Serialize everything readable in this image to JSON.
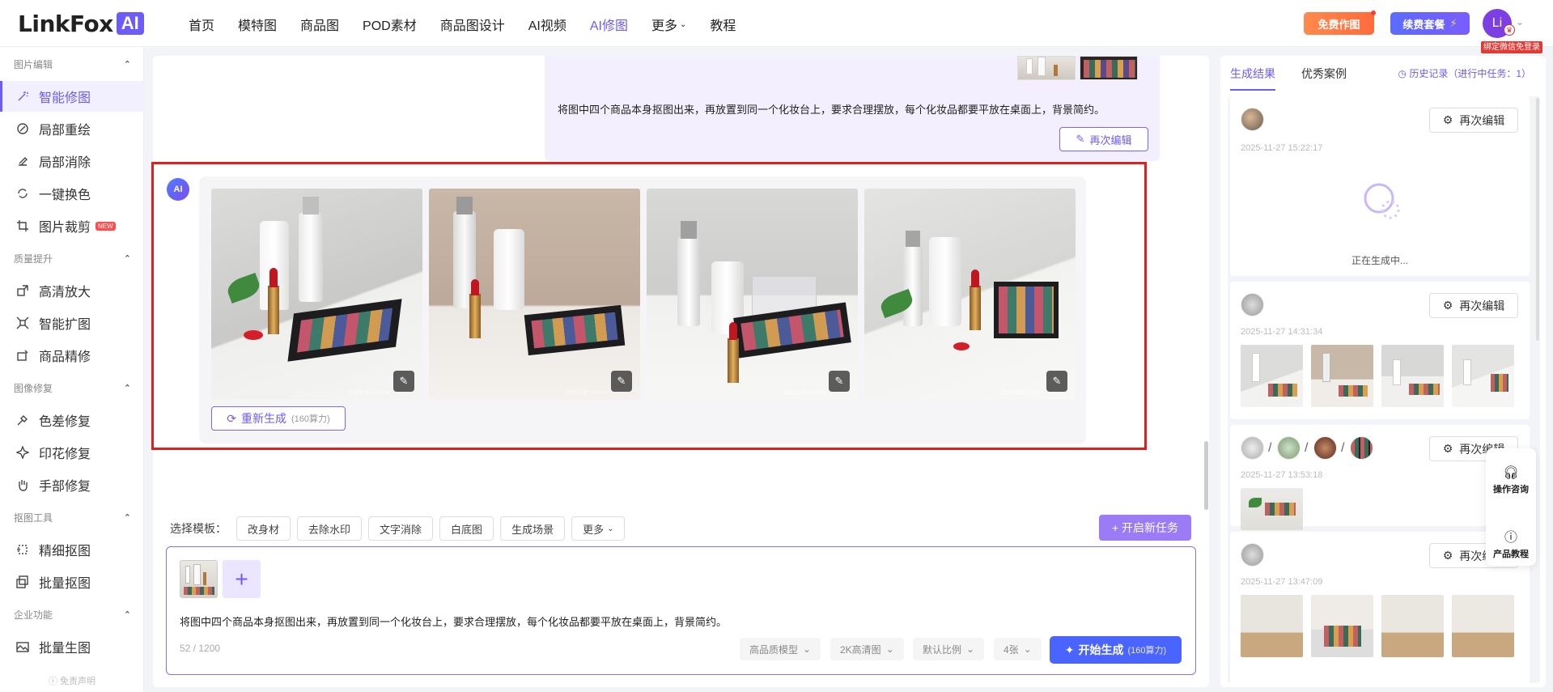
{
  "header": {
    "logo_text": "LinkFox",
    "logo_ai": "AI",
    "nav": [
      {
        "label": "首页",
        "active": false
      },
      {
        "label": "模特图",
        "active": false
      },
      {
        "label": "商品图",
        "active": false
      },
      {
        "label": "POD素材",
        "active": false
      },
      {
        "label": "商品图设计",
        "active": false
      },
      {
        "label": "AI视频",
        "active": false
      },
      {
        "label": "AI修图",
        "active": true
      },
      {
        "label": "更多",
        "active": false
      },
      {
        "label": "教程",
        "active": false
      }
    ],
    "free_btn": "免费作图",
    "plan_btn": "续费套餐",
    "avatar_initials": "Li",
    "bind_tag": "绑定微信免登录"
  },
  "sidebar": {
    "groups": [
      {
        "title": "图片编辑",
        "items": [
          {
            "label": "智能修图",
            "icon": "magic-wand-icon",
            "active": true
          },
          {
            "label": "局部重绘",
            "icon": "brush-icon"
          },
          {
            "label": "局部消除",
            "icon": "eraser-icon"
          },
          {
            "label": "一键换色",
            "icon": "color-swap-icon"
          },
          {
            "label": "图片裁剪",
            "icon": "crop-icon",
            "badge": "NEW"
          }
        ]
      },
      {
        "title": "质量提升",
        "items": [
          {
            "label": "高清放大",
            "icon": "expand-icon"
          },
          {
            "label": "智能扩图",
            "icon": "extend-icon"
          },
          {
            "label": "商品精修",
            "icon": "retouch-icon"
          }
        ]
      },
      {
        "title": "图像修复",
        "items": [
          {
            "label": "色差修复",
            "icon": "dropper-icon"
          },
          {
            "label": "印花修复",
            "icon": "pattern-icon"
          },
          {
            "label": "手部修复",
            "icon": "hand-icon"
          }
        ]
      },
      {
        "title": "抠图工具",
        "items": [
          {
            "label": "精细抠图",
            "icon": "cutout-icon"
          },
          {
            "label": "批量抠图",
            "icon": "batch-cutout-icon"
          }
        ]
      },
      {
        "title": "企业功能",
        "items": [
          {
            "label": "批量生图",
            "icon": "batch-image-icon"
          }
        ]
      }
    ],
    "disclaimer": "免责声明"
  },
  "chat": {
    "user_prompt": "将图中四个商品本身抠图出来，再放置到同一个化妆台上，要求合理摆放，每个化妆品都要平放在桌面上，背景简约。",
    "re_edit_label": "再次编辑",
    "ai_badge": "AI",
    "regen_label": "重新生成",
    "regen_cost": "(160算力)",
    "watermark": "本图片由 Linkfox"
  },
  "templates": {
    "label": "选择模板：",
    "items": [
      "改身材",
      "去除水印",
      "文字消除",
      "白底图",
      "生成场景",
      "更多"
    ],
    "new_task": "+ 开启新任务"
  },
  "input": {
    "text": "将图中四个商品本身抠图出来，再放置到同一个化妆台上，要求合理摆放，每个化妆品都要平放在桌面上，背景简约。",
    "count": "52 / 1200",
    "model": "高品质模型",
    "resolution": "2K高清图",
    "ratio": "默认比例",
    "quantity": "4张",
    "start_label": "开始生成",
    "start_cost": "(160算力)"
  },
  "results": {
    "tabs": [
      "生成结果",
      "优秀案例"
    ],
    "history": "历史记录（进行中任务：1）",
    "re_edit": "再次编辑",
    "generating": "正在生成中...",
    "cards": [
      {
        "time": "2025-11-27 15:22:17"
      },
      {
        "time": "2025-11-27 14:31:34"
      },
      {
        "time": "2025-11-27 13:53:18"
      },
      {
        "time": "2025-11-27 13:47:09"
      }
    ]
  },
  "float": {
    "consult": "操作咨询",
    "tutorial": "产品教程"
  }
}
